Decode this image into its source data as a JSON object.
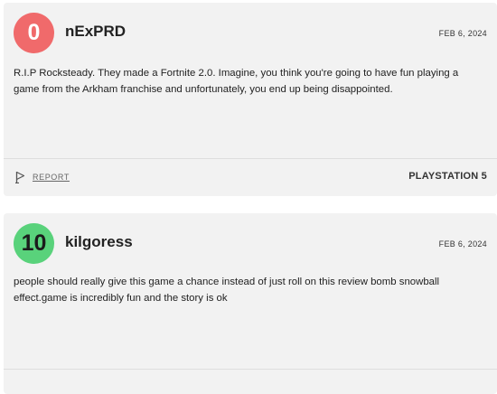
{
  "reviews": [
    {
      "score": "0",
      "score_color": "#f06a6b",
      "username": "nExPRD",
      "date": "FEB 6, 2024",
      "text": "R.I.P Rocksteady. They made a Fortnite 2.0. Imagine, you think you're going to have fun playing a game from the Arkham franchise and unfortunately, you end up being disappointed.",
      "report_label": "REPORT",
      "report_icon": "flag-icon",
      "platform": "PLAYSTATION 5"
    },
    {
      "score": "10",
      "score_color": "#59d27b",
      "username": "kilgoress",
      "date": "FEB 6, 2024",
      "text": "people should really give this game a chance instead of just roll on this review bomb snowball effect.game is incredibly fun and the story is ok"
    }
  ]
}
